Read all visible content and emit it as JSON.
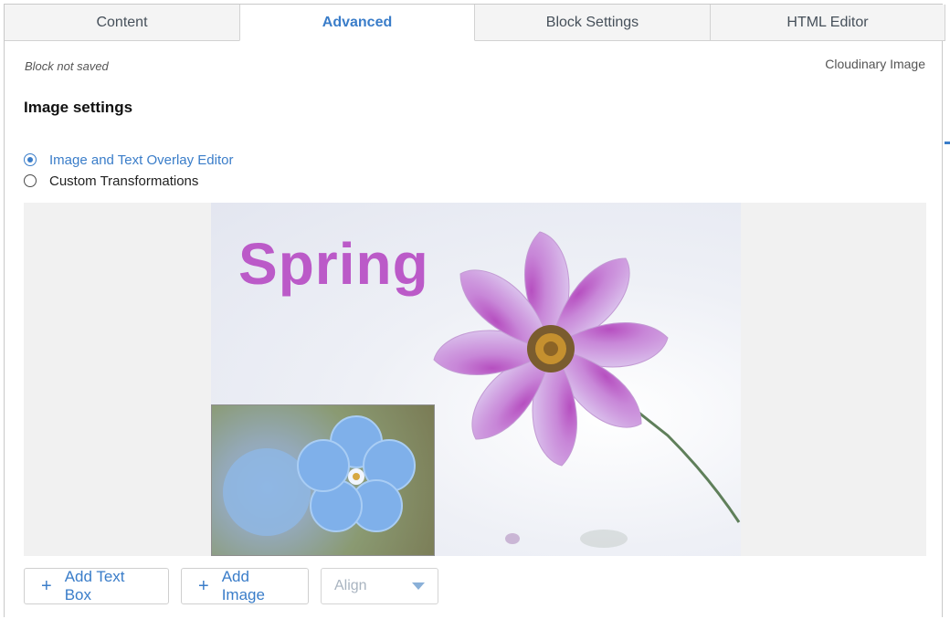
{
  "tabs": [
    {
      "label": "Content",
      "active": false
    },
    {
      "label": "Advanced",
      "active": true
    },
    {
      "label": "Block Settings",
      "active": false
    },
    {
      "label": "HTML Editor",
      "active": false
    }
  ],
  "status_text": "Block not saved",
  "block_type": "Cloudinary Image",
  "section_title": "Image settings",
  "radio_options": [
    {
      "label": "Image and Text Overlay Editor",
      "checked": true
    },
    {
      "label": "Custom Transformations",
      "checked": false
    }
  ],
  "preview": {
    "overlay_text": "Spring",
    "overlay_text_color": "#bb5ac8"
  },
  "toolbar": {
    "add_text_box": "Add Text Box",
    "add_image": "Add Image",
    "align_placeholder": "Align"
  },
  "colors": {
    "accent": "#3a7dc9",
    "tab_bg": "#f4f4f4",
    "preview_bg": "#f1f1f1"
  },
  "icons": {
    "plus": "plus-icon",
    "caret": "chevron-down-icon"
  }
}
